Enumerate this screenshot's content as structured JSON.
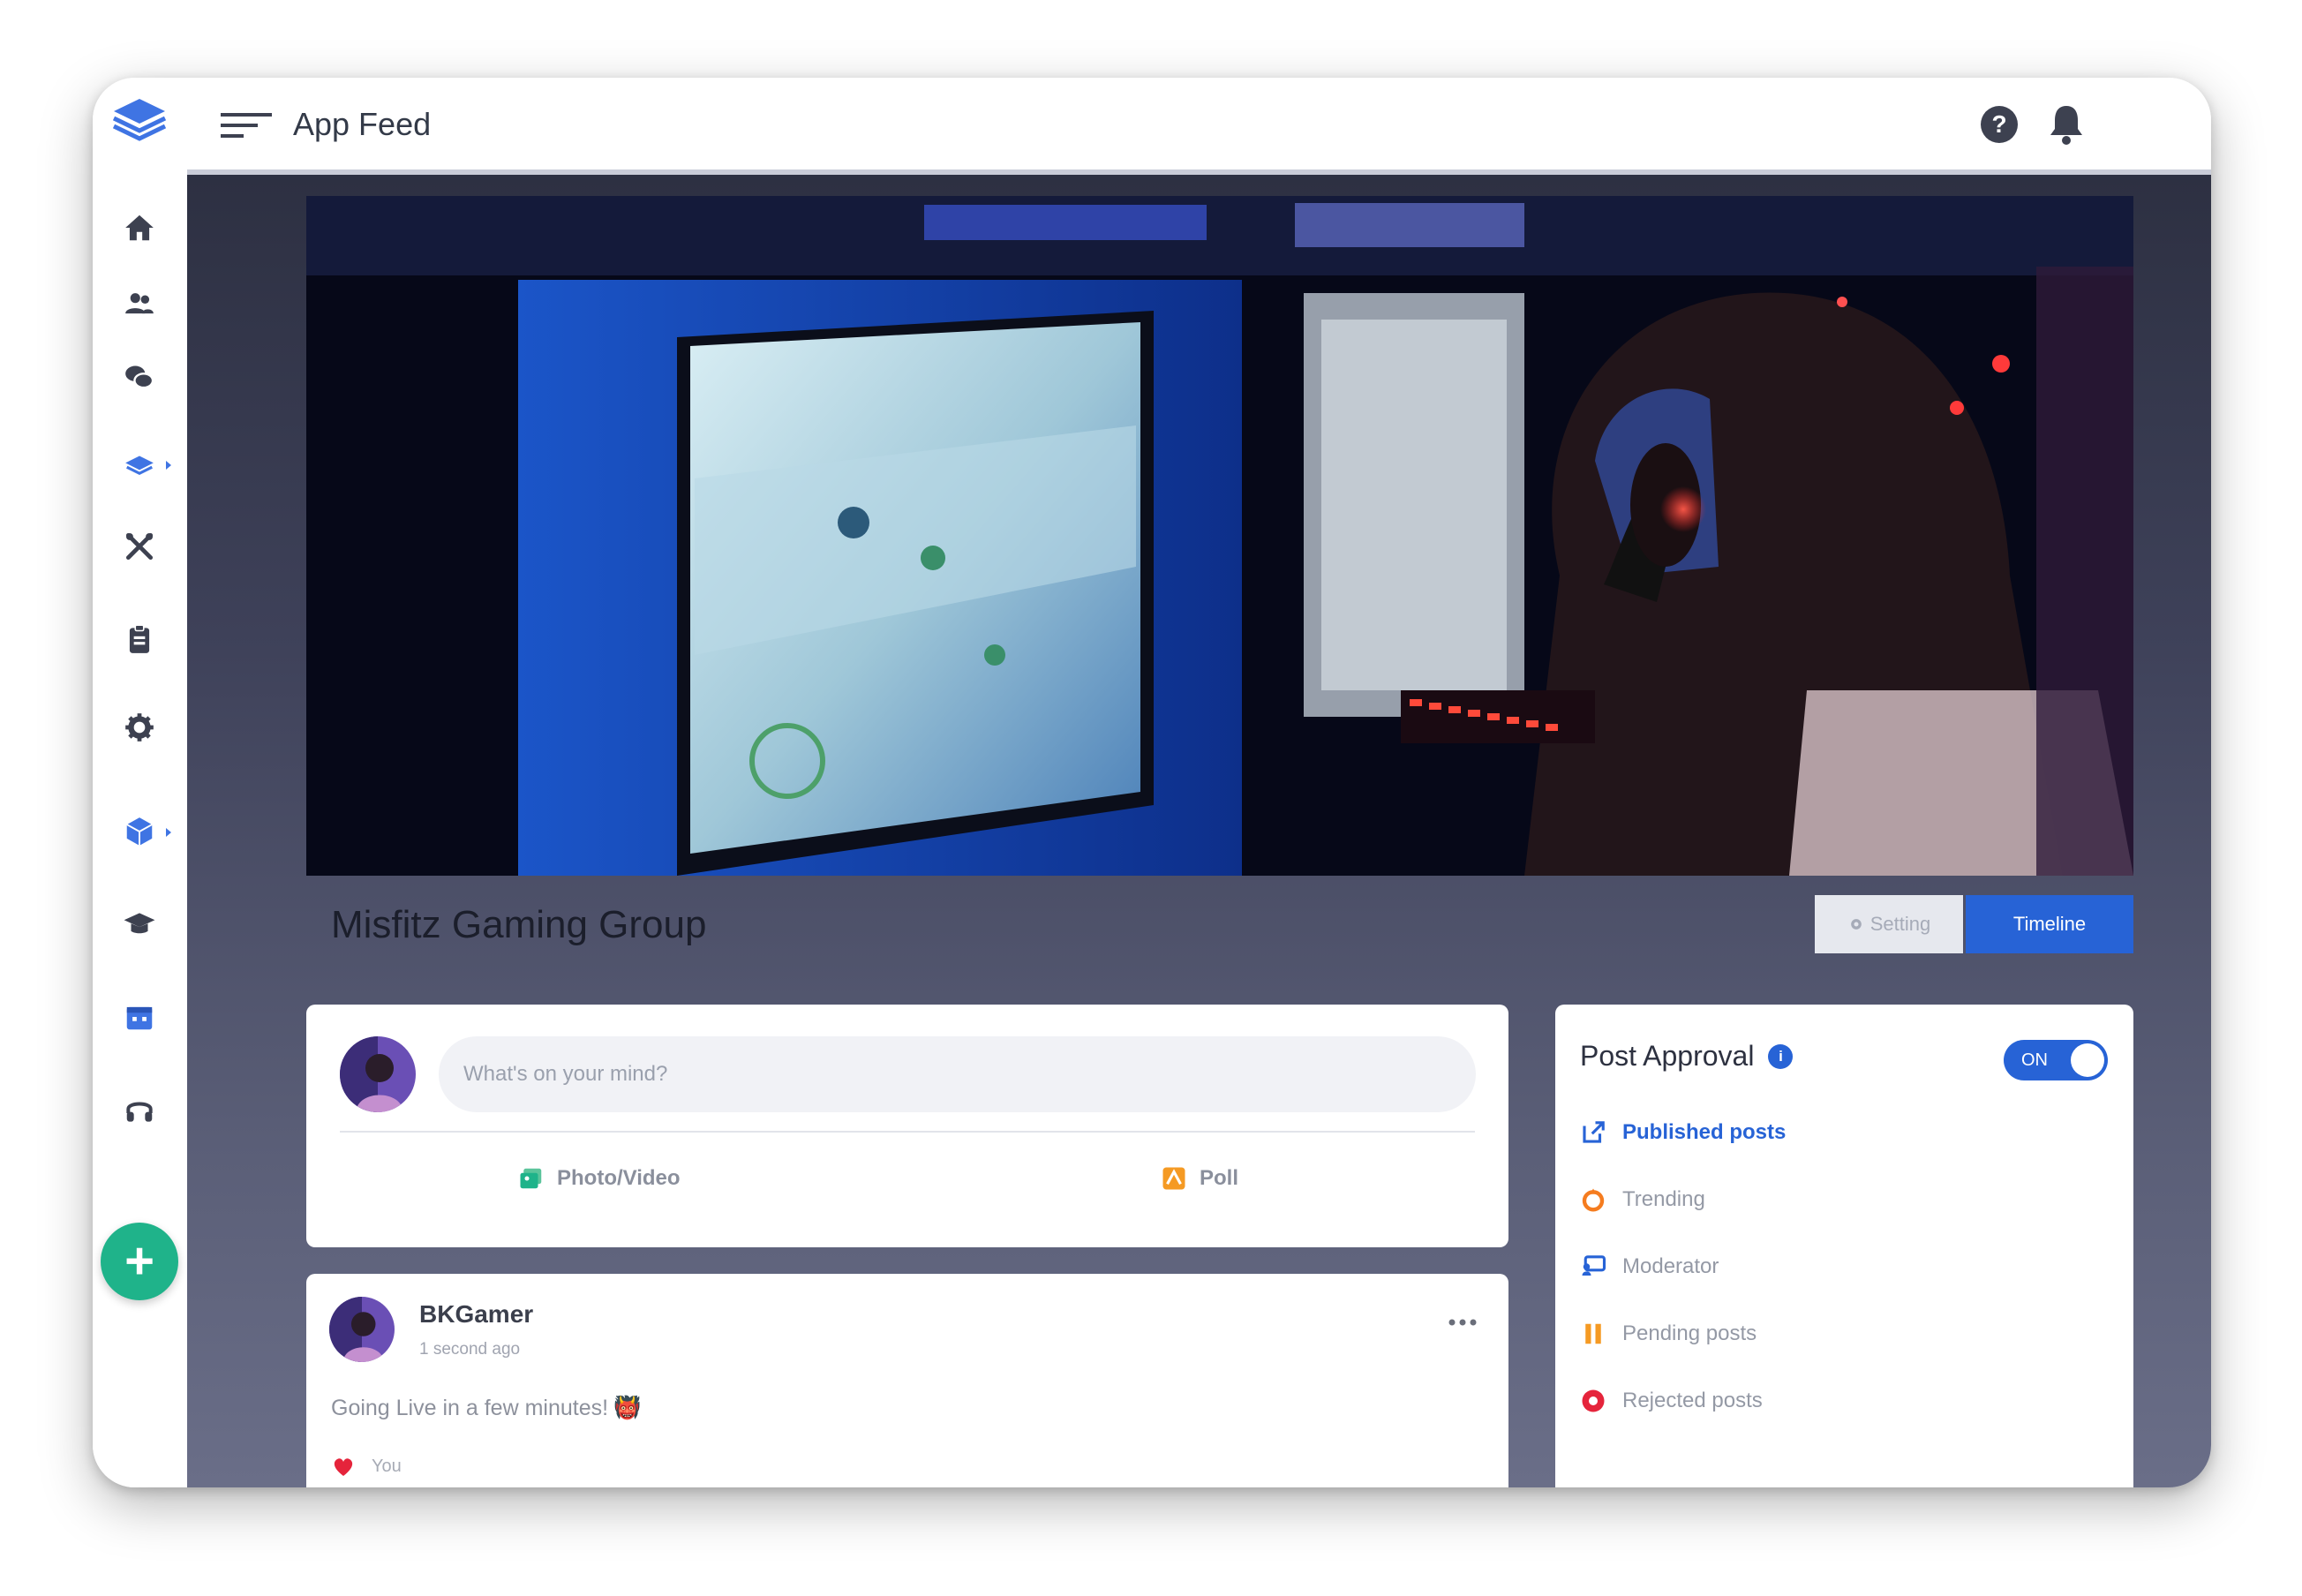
{
  "topbar": {
    "title": "App Feed"
  },
  "group": {
    "name": "Misfitz Gaming Group",
    "setting_label": "Setting",
    "timeline_label": "Timeline"
  },
  "composer": {
    "placeholder": "What's on your mind?",
    "photo_label": "Photo/Video",
    "poll_label": "Poll"
  },
  "post": {
    "author": "BKGamer",
    "time": "1 second ago",
    "text": "Going Live in a few minutes!",
    "emoji": "👹",
    "liked_by": "You"
  },
  "approval": {
    "title": "Post Approval",
    "info": "i",
    "toggle_label": "ON",
    "items": [
      {
        "label": "Published posts",
        "icon": "external-link-icon",
        "active": true
      },
      {
        "label": "Trending",
        "icon": "fire-icon",
        "active": false
      },
      {
        "label": "Moderator",
        "icon": "moderator-icon",
        "active": false
      },
      {
        "label": "Pending posts",
        "icon": "pause-icon",
        "active": false
      },
      {
        "label": "Rejected posts",
        "icon": "rejected-icon",
        "active": false
      }
    ]
  },
  "sidebar": {
    "items": [
      "home-icon",
      "users-icon",
      "chat-icon",
      "layers-icon",
      "tools-icon",
      "clipboard-icon",
      "gear-icon",
      "cube-icon",
      "graduation-cap-icon",
      "calendar-icon",
      "headset-icon"
    ]
  },
  "colors": {
    "accent": "#2763d6",
    "add_button": "#1fb38a"
  }
}
